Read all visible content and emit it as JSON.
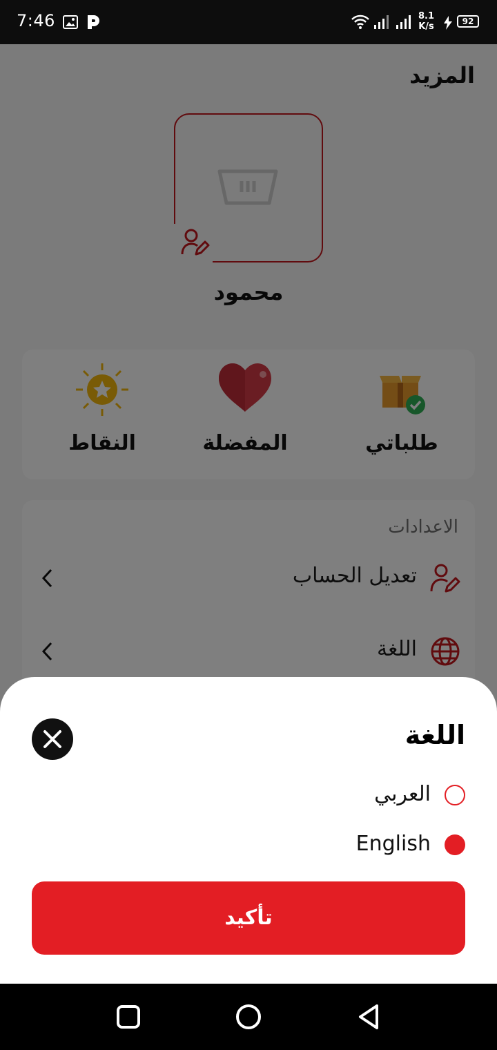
{
  "status_bar": {
    "time": "7:46",
    "network_speed_value": "8.1",
    "network_speed_unit": "K/s",
    "battery_level": "92",
    "icons": [
      "image-icon",
      "p-app-icon",
      "wifi-icon",
      "signal-icon",
      "signal-icon",
      "charging-icon",
      "battery-icon"
    ]
  },
  "page": {
    "title": "المزيد",
    "user_name": "محمود",
    "quick_actions": [
      {
        "label": "طلباتي",
        "icon": "orders-box-icon"
      },
      {
        "label": "المفضلة",
        "icon": "heart-icon"
      },
      {
        "label": "النقاط",
        "icon": "points-sun-star-icon"
      }
    ],
    "settings": {
      "heading": "الاعدادات",
      "items": [
        {
          "label": "تعديل الحساب",
          "icon": "edit-user-icon"
        },
        {
          "label": "اللغة",
          "icon": "globe-icon"
        }
      ]
    }
  },
  "language_sheet": {
    "title": "اللغة",
    "options": [
      {
        "label": "العربي",
        "selected": false
      },
      {
        "label": "English",
        "selected": true
      }
    ],
    "confirm_label": "تأكيد"
  },
  "colors": {
    "accent": "#e31e24",
    "avatar_border": "#c2161d",
    "dark": "#111111"
  }
}
